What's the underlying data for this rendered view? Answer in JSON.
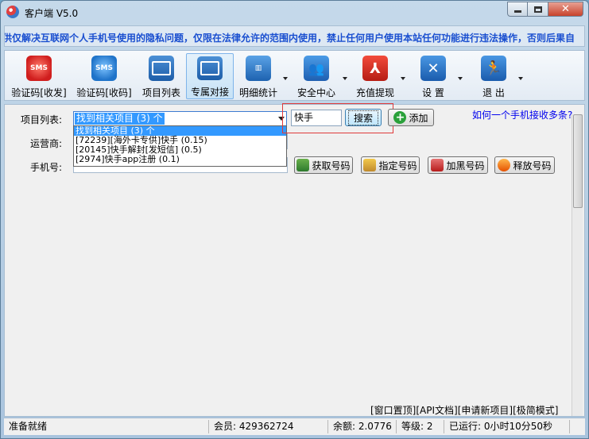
{
  "window": {
    "title": "客户端 V5.0"
  },
  "marquee": {
    "text": "供仅解决互联网个人手机号使用的隐私问题，仅限在法律允许的范围内使用，禁止任何用户使用本站任何功能进行违法操作，否则后果自"
  },
  "toolbar": {
    "items": [
      {
        "label": "验证码[收发]",
        "icon": "sms-red-icon",
        "icon_text": "SMS"
      },
      {
        "label": "验证码[收码]",
        "icon": "sms-blue-icon",
        "icon_text": "SMS"
      },
      {
        "label": "项目列表",
        "icon": "monitor-icon"
      },
      {
        "label": "专属对接",
        "icon": "monitor-icon",
        "active": true
      },
      {
        "label": "明细统计",
        "icon": "bar-chart-icon"
      },
      {
        "label": "安全中心",
        "icon": "people-icon"
      },
      {
        "label": "充值提现",
        "icon": "pdf-icon"
      },
      {
        "label": "设 置",
        "icon": "tools-icon"
      },
      {
        "label": "退 出",
        "icon": "exit-icon"
      }
    ]
  },
  "form": {
    "project_label": "项目列表:",
    "carrier_label": "运营商:",
    "phone_label": "手机号:",
    "combo_value": "找到相关项目 (3) 个",
    "options": [
      "找到相关项目 (3) 个",
      "[72239][海外卡专供]快手 (0.15)",
      "[20145]快手解封[发短信] (0.5)",
      "[2974]快手app注册 (0.1)"
    ],
    "search_value": "快手",
    "search_button": "搜索",
    "add_button": "添加",
    "help_link": "如何一个手机接收多条?",
    "get_number": "获取号码",
    "assign_number": "指定号码",
    "blacklist_number": "加黑号码",
    "release_number": "释放号码"
  },
  "footer": {
    "links": "[窗口置顶][API文档][申请新项目][极简模式]"
  },
  "status": {
    "ready": "准备就绪",
    "member": "会员: 429362724",
    "balance": "余额: 2.0776",
    "level": "等级: 2",
    "running": "已运行: 0小时10分50秒"
  },
  "colors": {
    "accent": "#3399ff",
    "marquee_text": "#1a4fd0",
    "highlight_box": "#e03a3a",
    "link": "#0000ee"
  }
}
